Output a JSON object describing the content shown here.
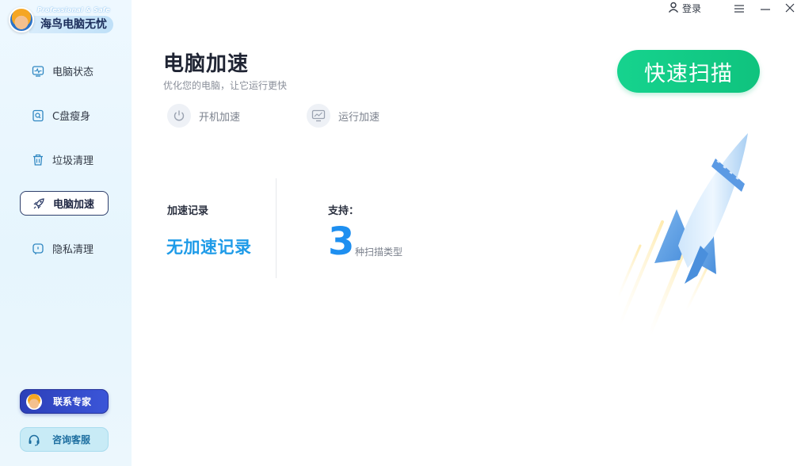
{
  "brand": {
    "slogan": "Professional & Safe",
    "title": "海鸟电脑无忧"
  },
  "sidebar": {
    "items": [
      {
        "label": "电脑状态",
        "icon": "monitor-pulse-icon",
        "active": false
      },
      {
        "label": "C盘瘦身",
        "icon": "disk-search-icon",
        "active": false
      },
      {
        "label": "垃圾清理",
        "icon": "trash-icon",
        "active": false
      },
      {
        "label": "电脑加速",
        "icon": "rocket-icon",
        "active": true
      },
      {
        "label": "隐私清理",
        "icon": "privacy-icon",
        "active": false
      }
    ],
    "contact_label": "联系专家",
    "service_label": "咨询客服"
  },
  "topbar": {
    "login_label": "登录",
    "icons": [
      "user-icon",
      "menu-icon",
      "minimize-icon",
      "close-icon"
    ]
  },
  "main": {
    "title": "电脑加速",
    "subtitle": "优化您的电脑，让它运行更快",
    "scan_button": "快速扫描",
    "modes": [
      {
        "label": "开机加速",
        "icon": "power-icon"
      },
      {
        "label": "运行加速",
        "icon": "monitor-chart-icon"
      }
    ],
    "record_label": "加速记录",
    "record_value": "无加速记录",
    "support_label": "支持：",
    "support_count": "3",
    "support_unit": "种扫描类型"
  },
  "colors": {
    "accent_green": "#16d38e",
    "accent_blue": "#1e9be8",
    "nav_active_border": "#2f3f6b",
    "contact_button": "#2c3fb8"
  }
}
